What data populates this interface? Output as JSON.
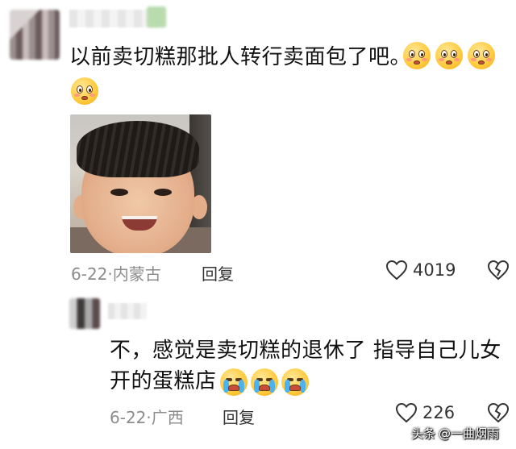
{
  "comment1": {
    "text": "以前卖切糕那批人转行卖面包了吧。",
    "emoji": "pleading-face-icon",
    "date": "6-22",
    "location": "内蒙古",
    "reply_label": "回复",
    "like_count": "4019"
  },
  "comment2": {
    "text": "不，感觉是卖切糕的退休了 指导自己儿女开的蛋糕店",
    "emoji": "crying-face-icon",
    "date": "6-22",
    "location": "广西",
    "reply_label": "回复",
    "like_count": "226"
  },
  "meta_separator": "·",
  "watermark": {
    "brand": "头条",
    "account": "@一曲烟雨"
  },
  "colors": {
    "text": "#111111",
    "meta": "#8c8c8c",
    "emoji_yellow": "#ffc93b"
  }
}
